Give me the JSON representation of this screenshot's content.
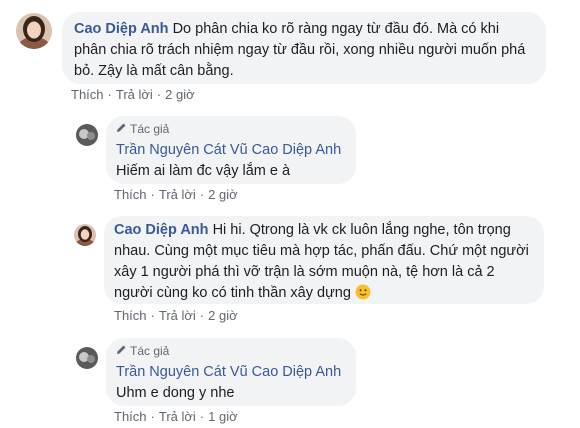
{
  "comments": [
    {
      "author": "Cao Diệp Anh",
      "lines": [
        "Do phân chia ko rõ ràng ngay từ đầu đó. Mà có khi",
        "phân chia rõ trách nhiệm ngay từ đầu rồi, xong nhiều người muốn phá",
        "bỏ. Zậy là mất cân bằng."
      ],
      "actions": {
        "like": "Thích",
        "reply": "Trả lời",
        "time": "2 giờ"
      }
    },
    {
      "badge": "Tác giả",
      "author": "Trần Nguyên Cát Vũ",
      "mention": "Cao Diệp Anh",
      "lines": [
        "Hiếm ai làm đc vậy lắm e à"
      ],
      "actions": {
        "like": "Thích",
        "reply": "Trả lời",
        "time": "2 giờ"
      }
    },
    {
      "author": "Cao Diệp Anh",
      "lines": [
        "Hi hi. Qtrong là vk ck luôn lắng nghe, tôn trọng",
        "nhau. Cùng một mục tiêu mà hợp tác, phấn đấu. Chứ một người",
        "xây 1 người phá thì vỡ trận là sớm muộn nà, tệ hơn là cả 2",
        "người cùng ko có tinh thần xây dựng"
      ],
      "emoji": "slightly-smiling-face",
      "actions": {
        "like": "Thích",
        "reply": "Trả lời",
        "time": "2 giờ"
      }
    },
    {
      "badge": "Tác giả",
      "author": "Trần Nguyên Cát Vũ",
      "mention": "Cao Diệp Anh",
      "lines": [
        "Uhm e dong y nhe"
      ],
      "actions": {
        "like": "Thích",
        "reply": "Trả lời",
        "time": "1 giờ"
      }
    }
  ],
  "colors": {
    "link": "#385898",
    "bubble": "#f2f3f5",
    "meta": "#606770"
  }
}
